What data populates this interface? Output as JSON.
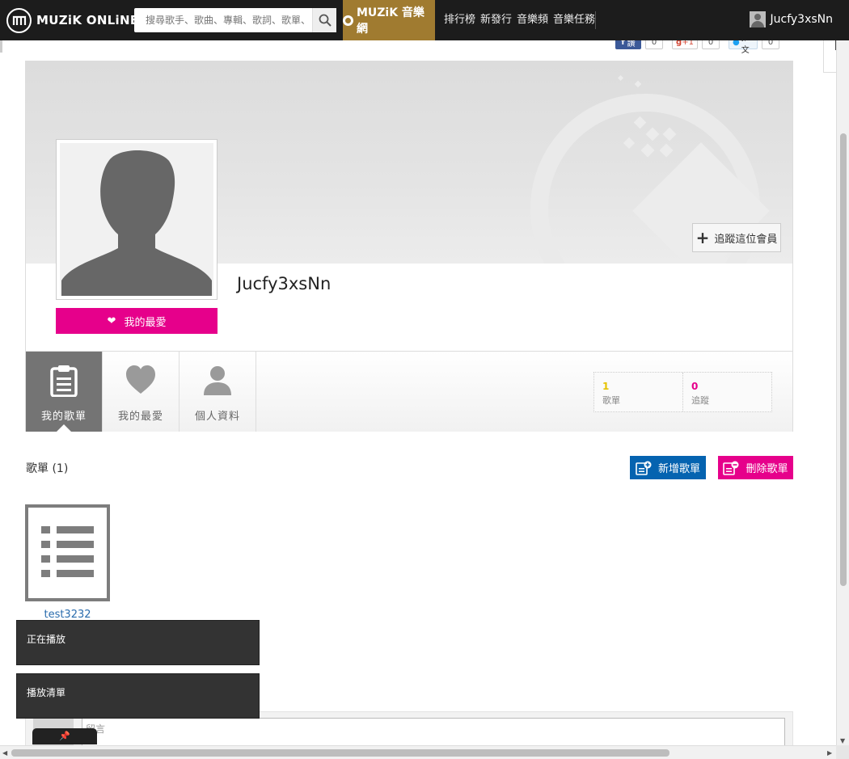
{
  "nav": {
    "logo_text": "MUZiK ONLiNE",
    "search_placeholder": "搜尋歌手、歌曲、專輯、歌詞、歌單、音樂人",
    "brand_label": "MUZiK 音樂網",
    "links": [
      "排行榜",
      "新發行",
      "音樂頻",
      "音樂任務"
    ],
    "user_name": "Jucfy3xsNn"
  },
  "share": {
    "facebook": {
      "label": "讚",
      "count": "0"
    },
    "gplus": {
      "label": "+1",
      "count": "0"
    },
    "twitter": {
      "label": "推文",
      "count": "0"
    }
  },
  "profile": {
    "username": "Jucfy3xsNn",
    "like_label": "我的最愛",
    "follow_label": "追蹤這位會員",
    "tabs": [
      "我的歌單",
      "我的最愛",
      "個人資料"
    ],
    "stats": [
      {
        "value": "1",
        "label": "歌單",
        "color": "#e6c200"
      },
      {
        "value": "0",
        "label": "追蹤",
        "color": "#e6008b"
      }
    ]
  },
  "lists": {
    "title": "歌單 (1)",
    "add_label": "新增歌單",
    "delete_label": "刪除歌單",
    "items": [
      {
        "name": "test3232"
      }
    ]
  },
  "toasts": [
    "正在播放",
    "播放清單"
  ],
  "comment": {
    "placeholder": "留言"
  },
  "colors": {
    "accent_gold": "#a07b30",
    "pink": "#e6008b",
    "blue": "#0563b0",
    "topbar": "#1c1c1c"
  }
}
